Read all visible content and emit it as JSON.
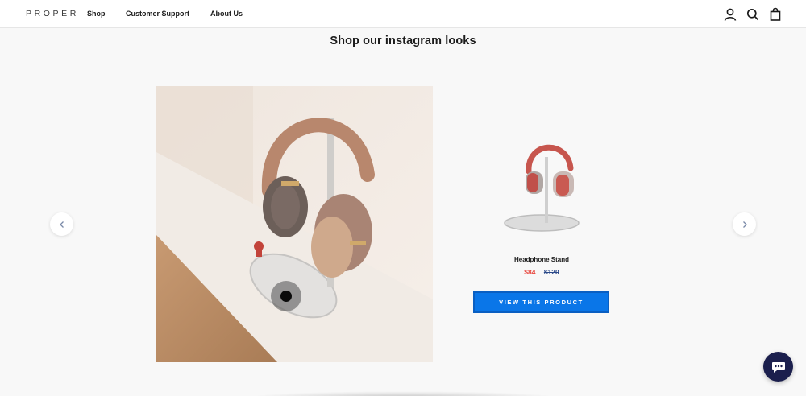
{
  "header": {
    "logo": "PROPER",
    "nav": [
      "Shop",
      "Customer Support",
      "About Us"
    ],
    "icons": [
      "account-icon",
      "search-icon",
      "cart-icon"
    ]
  },
  "section": {
    "title": "Shop our instagram looks"
  },
  "carousel": {
    "prev_icon": "chevron-left-icon",
    "next_icon": "chevron-right-icon"
  },
  "product": {
    "name": "Headphone Stand",
    "sale_price": "$84",
    "original_price": "$120",
    "cta": "VIEW THIS PRODUCT"
  },
  "chat": {
    "icon": "chat-bubble-icon"
  },
  "colors": {
    "accent": "#0a76e8",
    "sale": "#e8453c",
    "chat_bg": "#1b1f4d"
  }
}
